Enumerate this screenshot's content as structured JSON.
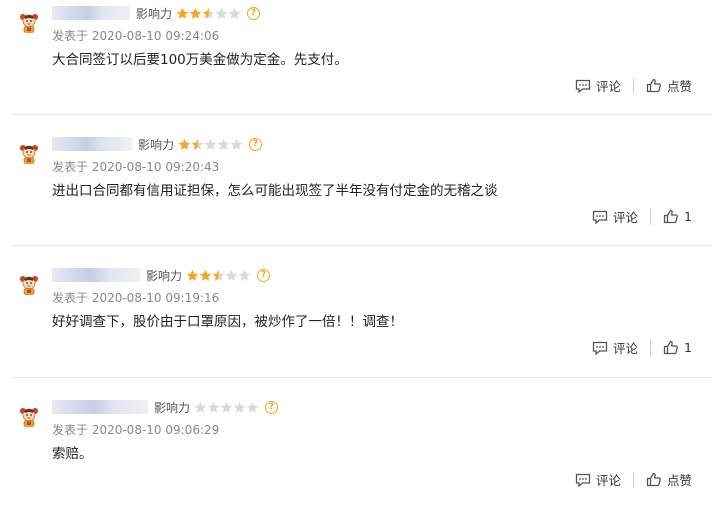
{
  "colors": {
    "star_filled": "#f5a623",
    "star_empty": "#d9d9d9",
    "help": "#f0a81c"
  },
  "comments": [
    {
      "influence_label": "影响力",
      "stars": 2.5,
      "post_time": "发表于 2020-08-10 09:24:06",
      "content": "大合同签订以后要100万美金做为定金。先支付。",
      "comment_label": "评论",
      "like_label": "点赞"
    },
    {
      "influence_label": "影响力",
      "stars": 1.5,
      "post_time": "发表于 2020-08-10 09:20:43",
      "content": "进出口合同都有信用证担保，怎么可能出现签了半年没有付定金的无稽之谈",
      "comment_label": "评论",
      "like_label": "1"
    },
    {
      "influence_label": "影响力",
      "stars": 2.5,
      "post_time": "发表于 2020-08-10 09:19:16",
      "content": "好好调查下，股价由于口罩原因，被炒作了一倍！！调查！",
      "comment_label": "评论",
      "like_label": "1"
    },
    {
      "influence_label": "影响力",
      "stars": 0,
      "post_time": "发表于 2020-08-10 09:06:29",
      "content": "索赔。",
      "comment_label": "评论",
      "like_label": "点赞"
    }
  ]
}
